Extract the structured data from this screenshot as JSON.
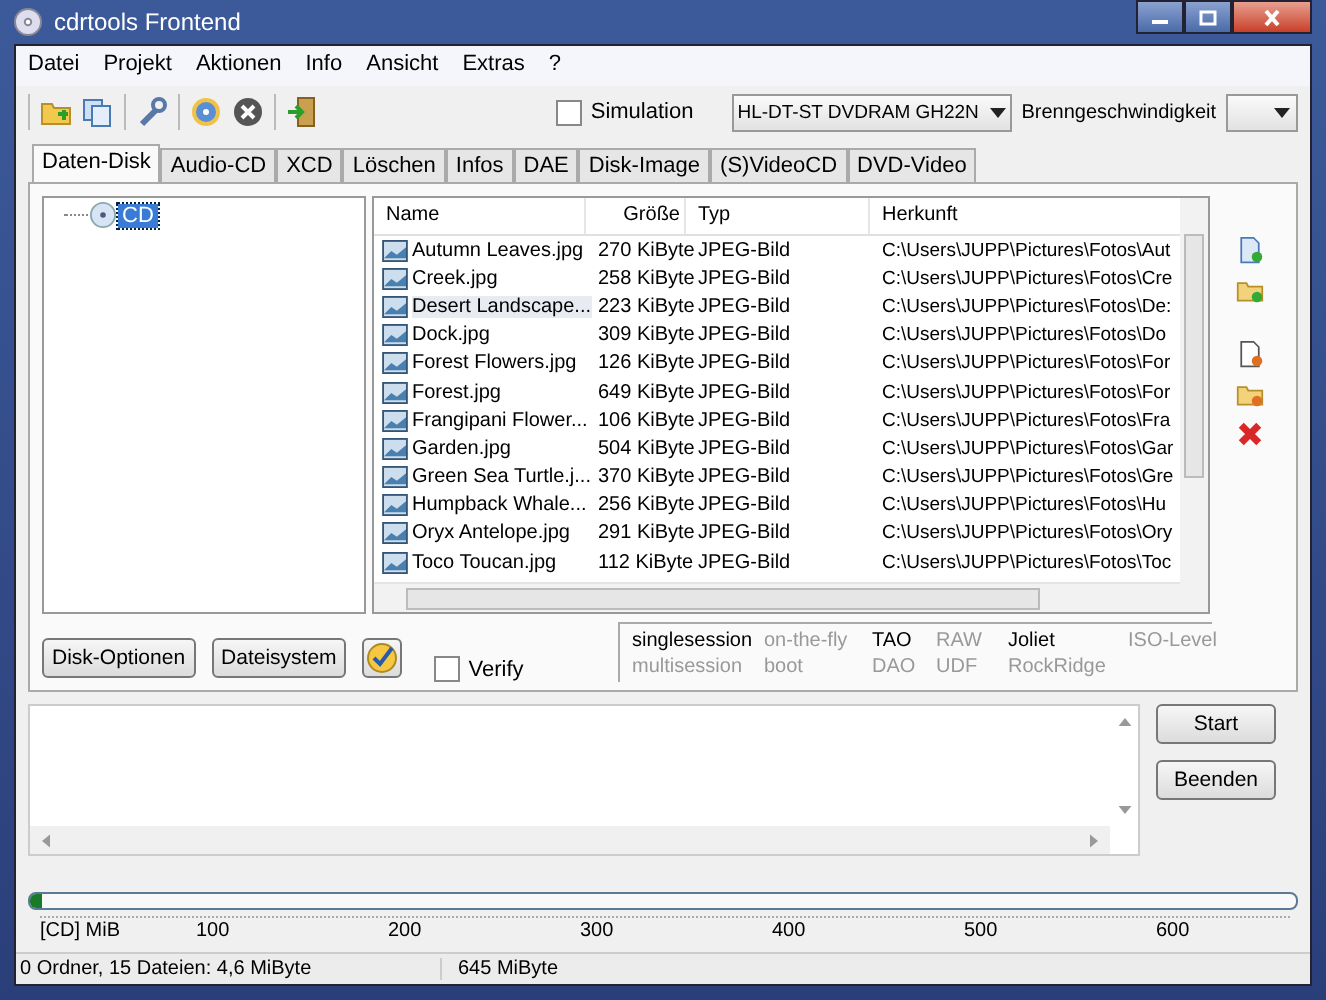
{
  "window": {
    "title": "cdrtools Frontend"
  },
  "menu": [
    "Datei",
    "Projekt",
    "Aktionen",
    "Info",
    "Ansicht",
    "Extras",
    "?"
  ],
  "toolbar": {
    "simulation": {
      "label": "Simulation",
      "checked": false
    },
    "drive": {
      "value": "HL-DT-ST DVDRAM GH22N"
    },
    "speed_label": "Brenngeschwindigkeit"
  },
  "tabs": [
    {
      "label": "Daten-Disk",
      "selected": true
    },
    {
      "label": "Audio-CD",
      "selected": false
    },
    {
      "label": "XCD",
      "selected": false
    },
    {
      "label": "Löschen",
      "selected": false
    },
    {
      "label": "Infos",
      "selected": false
    },
    {
      "label": "DAE",
      "selected": false
    },
    {
      "label": "Disk-Image",
      "selected": false
    },
    {
      "label": "(S)VideoCD",
      "selected": false
    },
    {
      "label": "DVD-Video",
      "selected": false
    }
  ],
  "tree": [
    {
      "label": "CD",
      "selected": true
    }
  ],
  "table": {
    "columns": [
      "Name",
      "Größe",
      "Typ",
      "Herkunft"
    ],
    "rows": [
      {
        "name": "Autumn Leaves.jpg",
        "size": "270 KiByte",
        "type": "JPEG-Bild",
        "source": "C:\\Users\\JUPP\\Pictures\\Fotos\\Aut",
        "selected": false
      },
      {
        "name": "Creek.jpg",
        "size": "258 KiByte",
        "type": "JPEG-Bild",
        "source": "C:\\Users\\JUPP\\Pictures\\Fotos\\Cre",
        "selected": false
      },
      {
        "name": "Desert Landscape...",
        "size": "223 KiByte",
        "type": "JPEG-Bild",
        "source": "C:\\Users\\JUPP\\Pictures\\Fotos\\De:",
        "selected": true
      },
      {
        "name": "Dock.jpg",
        "size": "309 KiByte",
        "type": "JPEG-Bild",
        "source": "C:\\Users\\JUPP\\Pictures\\Fotos\\Do",
        "selected": false
      },
      {
        "name": "Forest Flowers.jpg",
        "size": "126 KiByte",
        "type": "JPEG-Bild",
        "source": "C:\\Users\\JUPP\\Pictures\\Fotos\\For",
        "selected": false
      },
      {
        "name": "Forest.jpg",
        "size": "649 KiByte",
        "type": "JPEG-Bild",
        "source": "C:\\Users\\JUPP\\Pictures\\Fotos\\For",
        "selected": false
      },
      {
        "name": "Frangipani Flower...",
        "size": "106 KiByte",
        "type": "JPEG-Bild",
        "source": "C:\\Users\\JUPP\\Pictures\\Fotos\\Fra",
        "selected": false
      },
      {
        "name": "Garden.jpg",
        "size": "504 KiByte",
        "type": "JPEG-Bild",
        "source": "C:\\Users\\JUPP\\Pictures\\Fotos\\Gar",
        "selected": false
      },
      {
        "name": "Green Sea Turtle.j...",
        "size": "370 KiByte",
        "type": "JPEG-Bild",
        "source": "C:\\Users\\JUPP\\Pictures\\Fotos\\Gre",
        "selected": false
      },
      {
        "name": "Humpback Whale...",
        "size": "256 KiByte",
        "type": "JPEG-Bild",
        "source": "C:\\Users\\JUPP\\Pictures\\Fotos\\Hu",
        "selected": false
      },
      {
        "name": "Oryx Antelope.jpg",
        "size": "291 KiByte",
        "type": "JPEG-Bild",
        "source": "C:\\Users\\JUPP\\Pictures\\Fotos\\Ory",
        "selected": false
      },
      {
        "name": "Toco Toucan.jpg",
        "size": "112 KiByte",
        "type": "JPEG-Bild",
        "source": "C:\\Users\\JUPP\\Pictures\\Fotos\\Toc",
        "selected": false
      }
    ]
  },
  "buttons": [
    "Disk-Optionen",
    "Dateisystem"
  ],
  "verify": {
    "label": "Verify",
    "checked": false
  },
  "options": [
    {
      "label": "singlesession",
      "on": true
    },
    {
      "label": "on-the-fly",
      "on": false
    },
    {
      "label": "TAO",
      "on": true
    },
    {
      "label": "RAW",
      "on": false
    },
    {
      "label": "Joliet",
      "on": true
    },
    {
      "label": "ISO-Level",
      "on": false
    },
    {
      "label": "multisession",
      "on": false
    },
    {
      "label": "boot",
      "on": false
    },
    {
      "label": "DAO",
      "on": false
    },
    {
      "label": "UDF",
      "on": false
    },
    {
      "label": "RockRidge",
      "on": false
    }
  ],
  "actions": [
    "Start",
    "Beenden"
  ],
  "progress": {
    "level": 0.01
  },
  "scale": [
    "[CD] MiB",
    "100",
    "200",
    "300",
    "400",
    "500",
    "600"
  ],
  "status_bar": [
    "0 Ordner, 15 Dateien: 4,6 MiByte",
    "645 MiByte"
  ]
}
